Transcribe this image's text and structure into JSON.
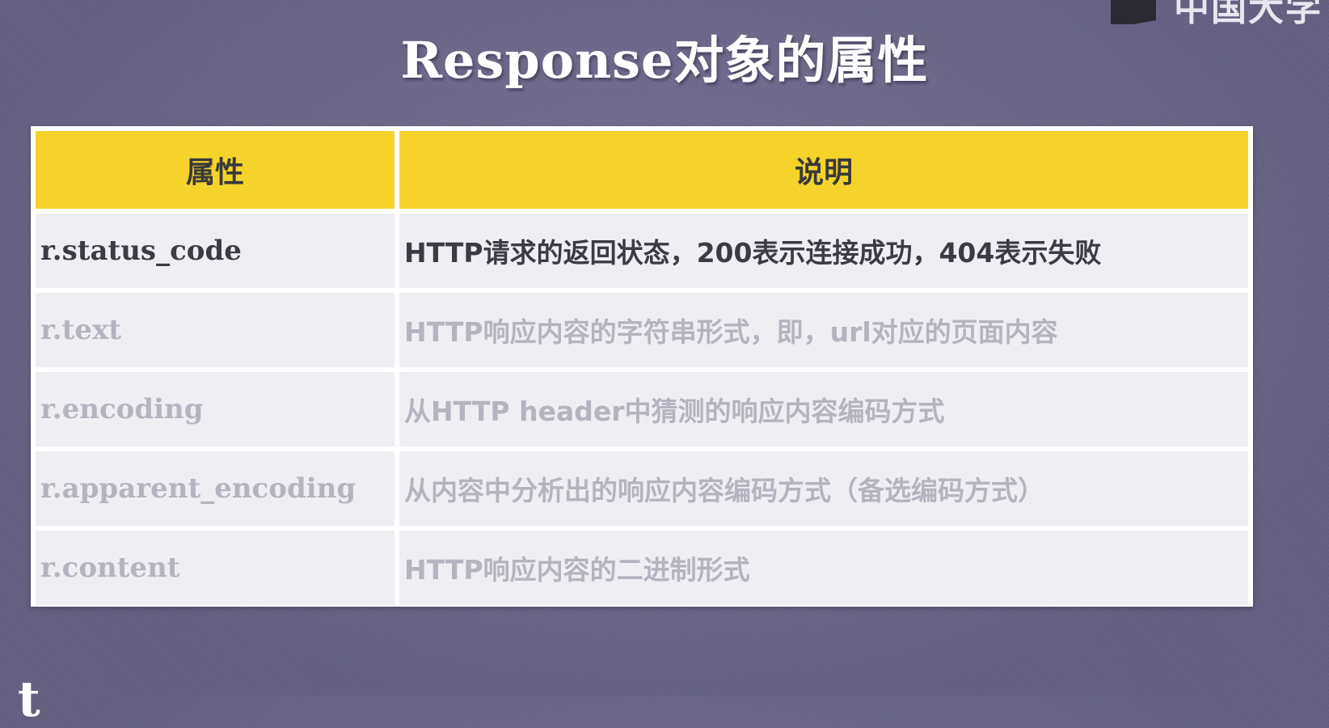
{
  "slide": {
    "title": "Response对象的属性",
    "logo_text": "中国大学",
    "bottom_fragment": "t"
  },
  "table": {
    "headers": [
      "属性",
      "说明"
    ],
    "rows": [
      {
        "attribute": "r.status_code",
        "description": "HTTP请求的返回状态，200表示连接成功，404表示失败",
        "highlighted": true
      },
      {
        "attribute": "r.text",
        "description": "HTTP响应内容的字符串形式，即，url对应的页面内容",
        "highlighted": false
      },
      {
        "attribute": "r.encoding",
        "description": "从HTTP header中猜测的响应内容编码方式",
        "highlighted": false
      },
      {
        "attribute": "r.apparent_encoding",
        "description": "从内容中分析出的响应内容编码方式（备选编码方式）",
        "highlighted": false
      },
      {
        "attribute": "r.content",
        "description": "HTTP响应内容的二进制形式",
        "highlighted": false
      }
    ]
  },
  "colors": {
    "background": "#6f6a8f",
    "header_fill": "#f5d32b",
    "row_fill": "#eeeef3",
    "active_text": "#3b3b45",
    "dim_text": "#b4b3bf"
  }
}
